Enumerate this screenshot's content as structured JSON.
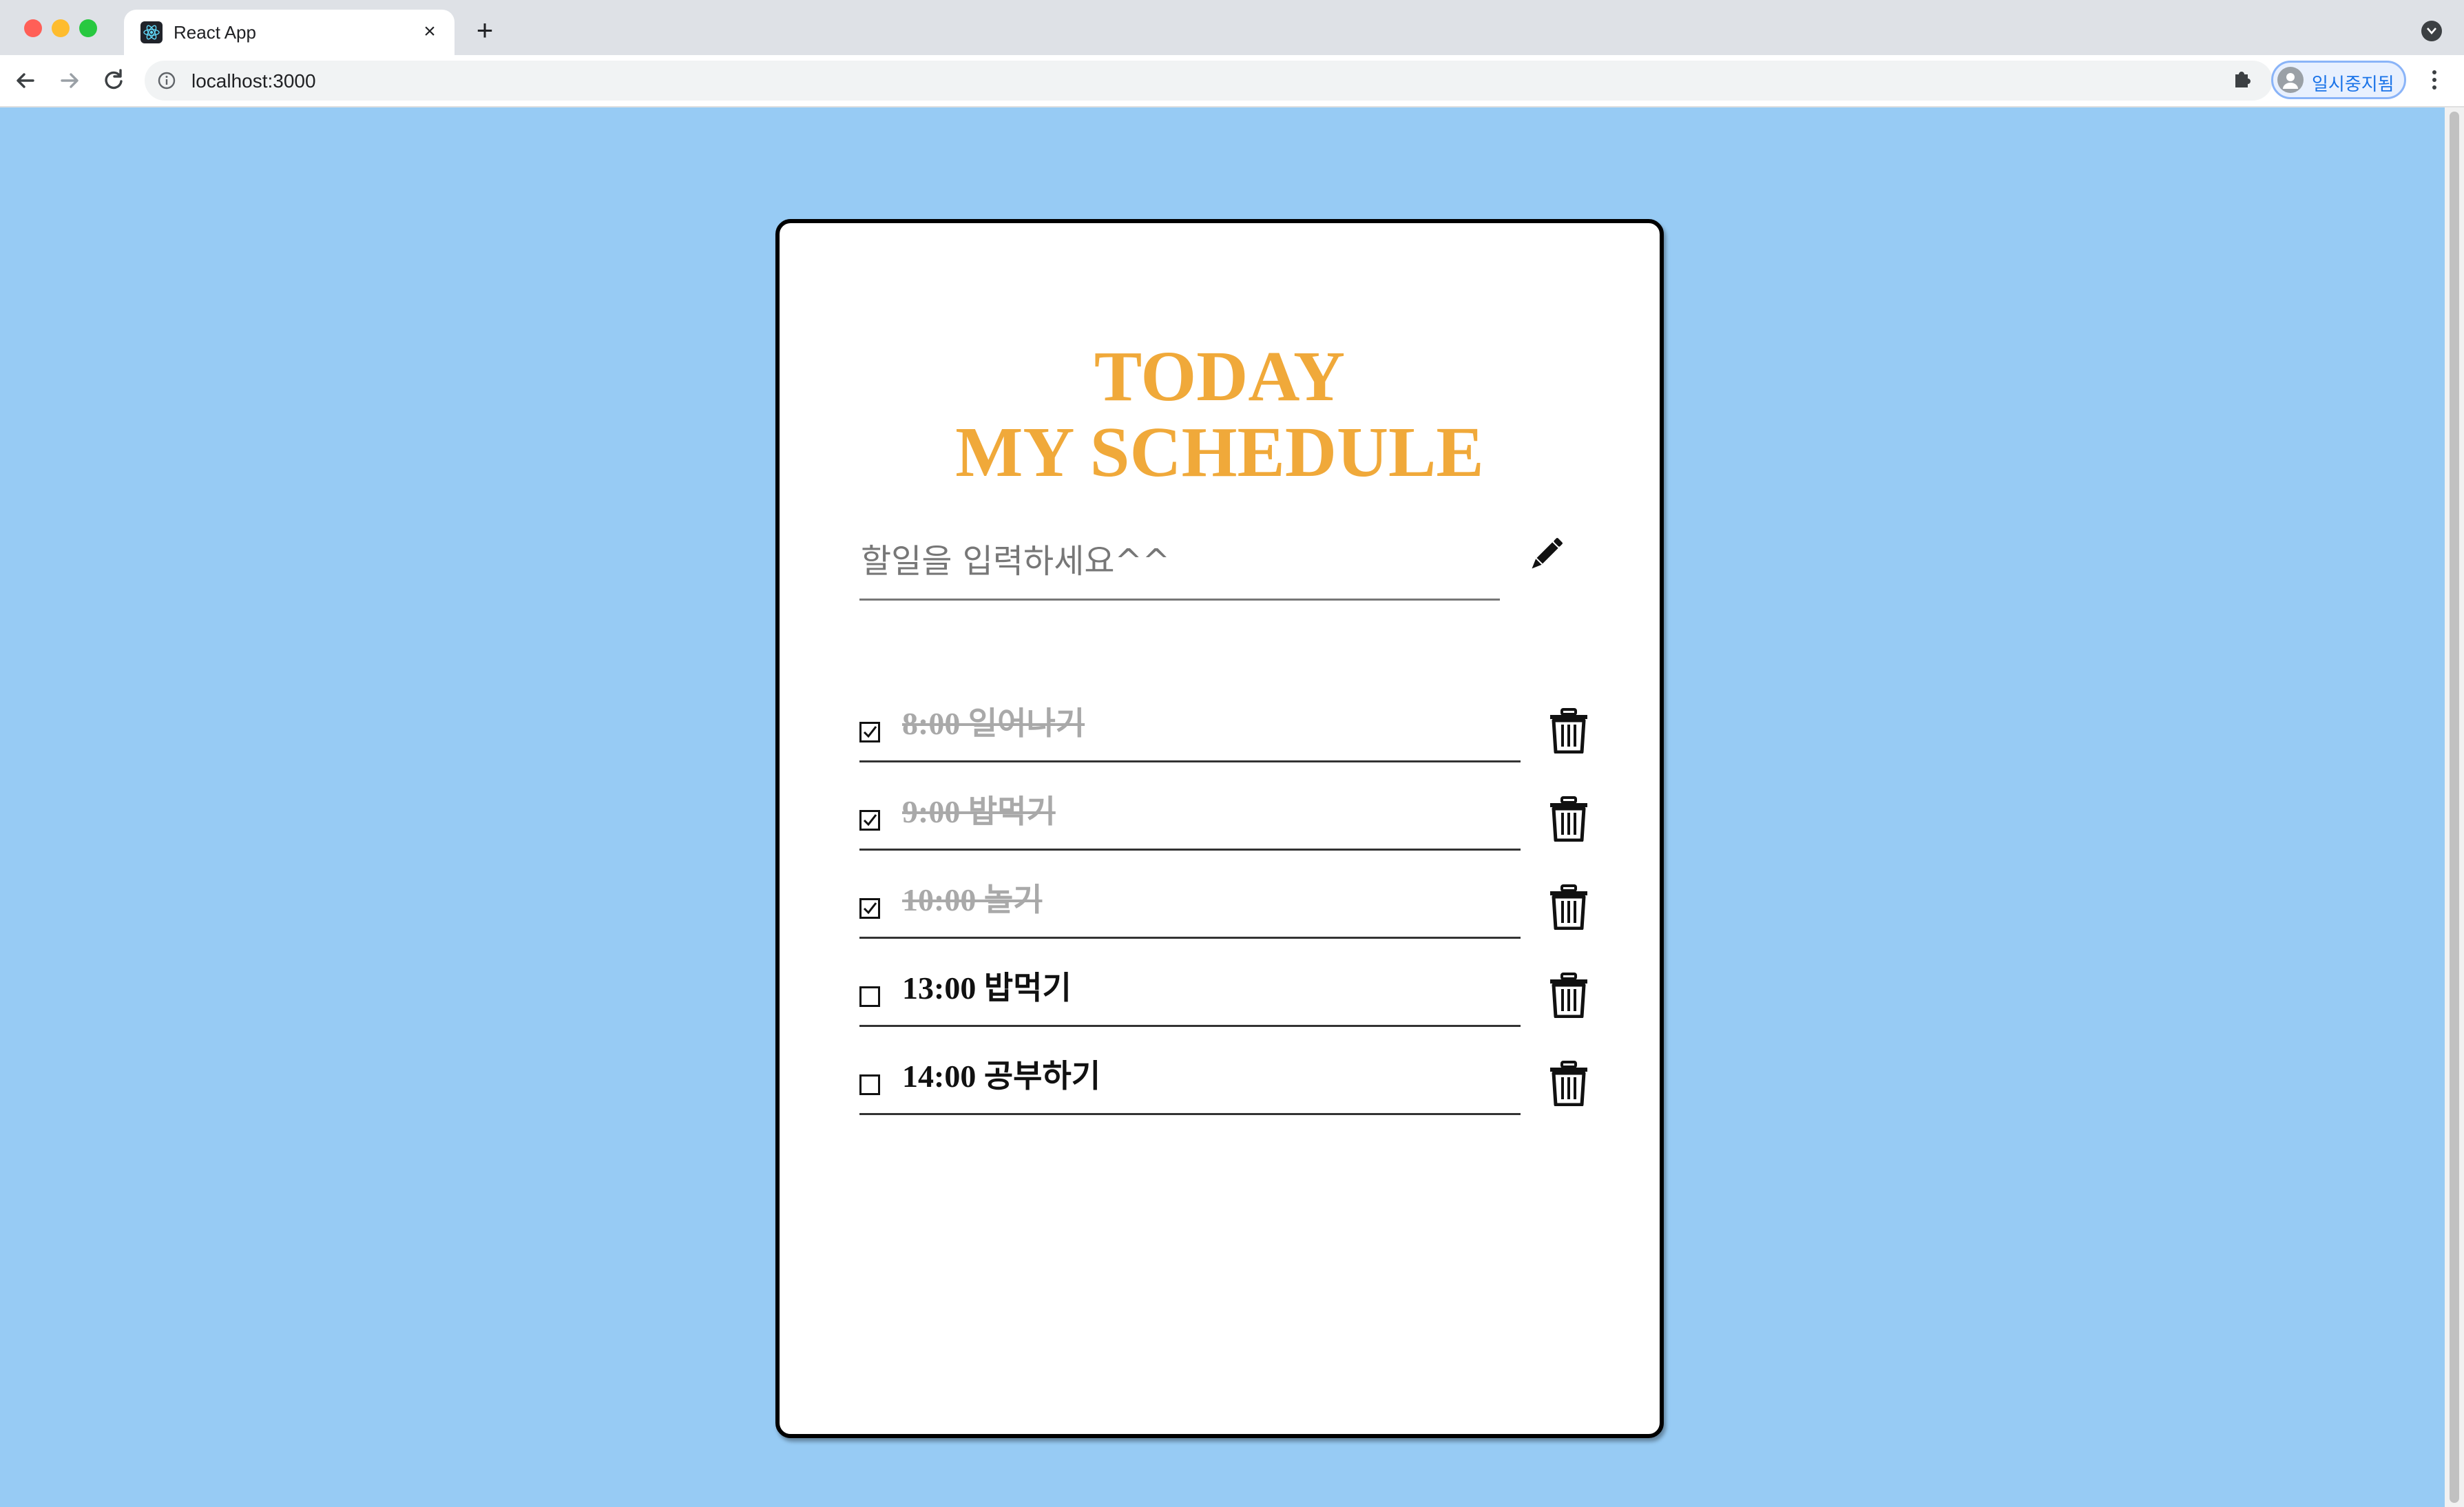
{
  "browser": {
    "tab_title": "React App",
    "tab_close": "×",
    "new_tab": "+",
    "url": "localhost:3000",
    "profile_label": "일시중지됨"
  },
  "app": {
    "title_line1": "TODAY",
    "title_line2": "MY SCHEDULE",
    "input_placeholder": "할일을 입력하세요^^",
    "input_value": "",
    "items": [
      {
        "text": "8:00 일어나기",
        "done": true
      },
      {
        "text": "9:00 밥먹기",
        "done": true
      },
      {
        "text": "10:00 놀기",
        "done": true
      },
      {
        "text": "13:00 밥먹기",
        "done": false
      },
      {
        "text": "14:00 공부하기",
        "done": false
      }
    ]
  },
  "colors": {
    "page_background": "#97cbf4",
    "title": "#f0a93a",
    "done_text": "#a9a9a9"
  },
  "icons": {
    "add": "pencil-icon",
    "delete": "trash-icon",
    "checked": "checkbox-checked-icon",
    "unchecked": "checkbox-unchecked-icon"
  }
}
